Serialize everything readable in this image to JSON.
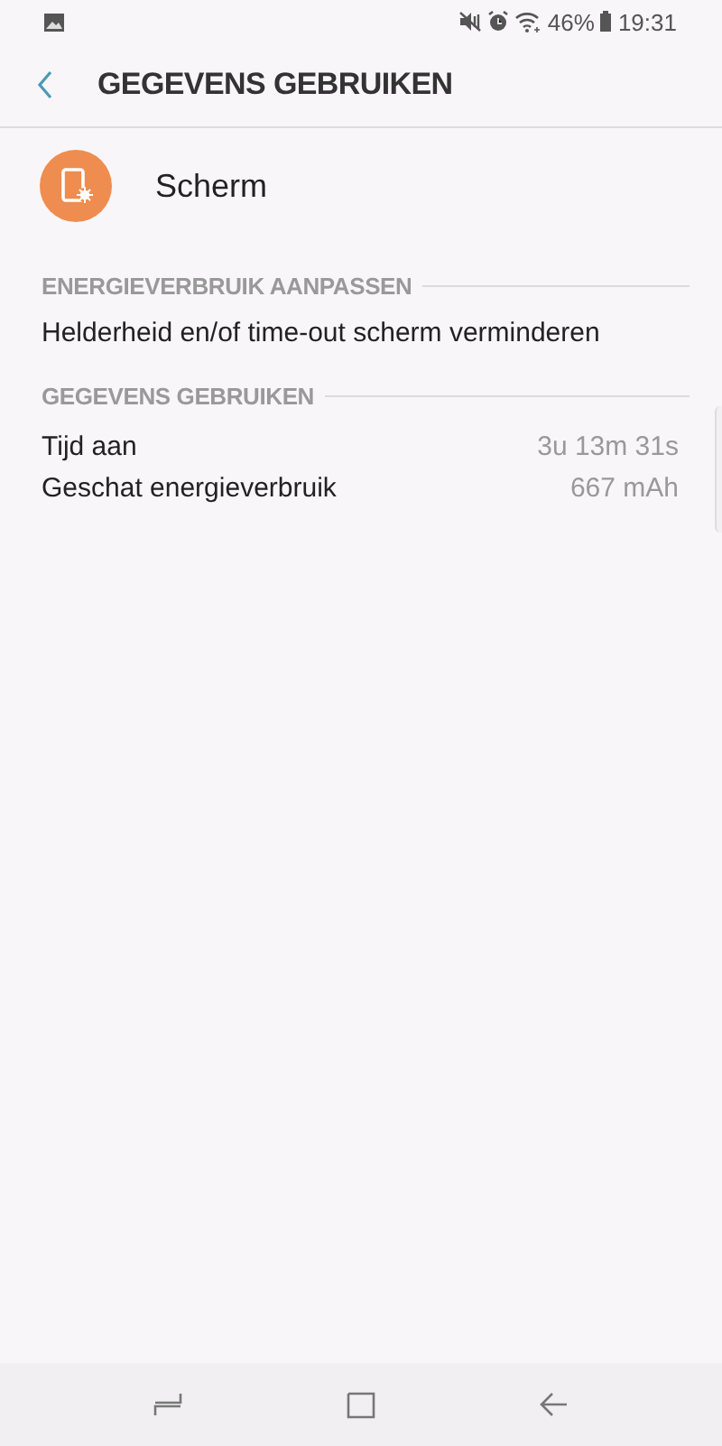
{
  "status_bar": {
    "battery_percent": "46%",
    "time": "19:31"
  },
  "header": {
    "title": "GEGEVENS GEBRUIKEN"
  },
  "app": {
    "name": "Scherm"
  },
  "sections": [
    {
      "title": "ENERGIEVERBRUIK AANPASSEN",
      "rows": [
        {
          "label": "Helderheid en/of time-out scherm verminderen"
        }
      ]
    },
    {
      "title": "GEGEVENS GEBRUIKEN",
      "rows": [
        {
          "label": "Tijd aan",
          "value": "3u 13m 31s"
        },
        {
          "label": "Geschat energieverbruik",
          "value": "667 mAh"
        }
      ]
    }
  ]
}
